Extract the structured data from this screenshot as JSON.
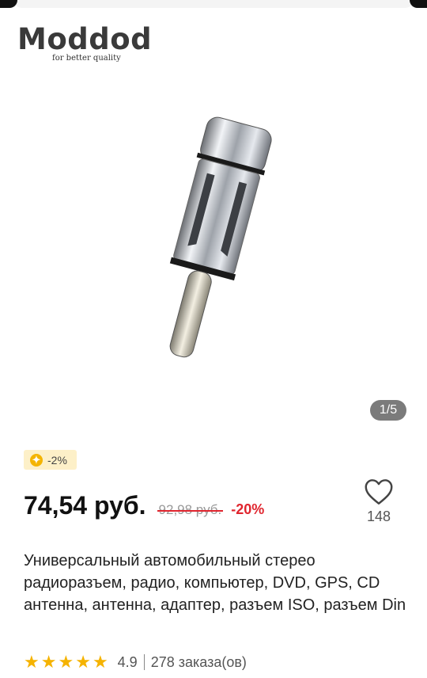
{
  "gallery": {
    "brand": {
      "name": "Moddod",
      "tagline": "for better quality"
    },
    "image_counter": "1/5"
  },
  "coupon": {
    "icon": "coin-icon",
    "text": "-2%"
  },
  "price": {
    "current": "74,54 руб.",
    "old": "92,98 руб.",
    "discount": "-20%"
  },
  "wishlist": {
    "icon": "heart-icon",
    "count": "148"
  },
  "product": {
    "title": "Универсальный автомобильный стерео радиоразъем, радио, компьютер, DVD, GPS, CD антенна, антенна, адаптер, разъем ISO, разъем Din"
  },
  "rating": {
    "stars": 5,
    "value": "4.9",
    "orders": "278 заказа(ов)"
  },
  "colors": {
    "accent_red": "#e0252e",
    "star_yellow": "#f5b301",
    "coupon_bg": "#fdf0c8"
  }
}
